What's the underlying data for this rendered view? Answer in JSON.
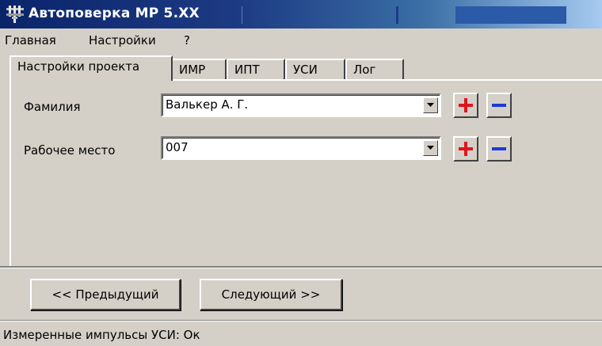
{
  "window": {
    "title": "Автоповерка МР 5.XX",
    "icon": "app-fork-icon"
  },
  "menu": {
    "items": [
      "Главная",
      "Настройки",
      "?"
    ]
  },
  "tabs": [
    {
      "label": "Настройки проекта",
      "active": true
    },
    {
      "label": "ИМР",
      "active": false
    },
    {
      "label": "ИПТ",
      "active": false
    },
    {
      "label": "УСИ",
      "active": false
    },
    {
      "label": "Лог",
      "active": false
    }
  ],
  "form": {
    "surname": {
      "label": "Фамилия",
      "value": "Валькер А. Г."
    },
    "workplace": {
      "label": "Рабочее место",
      "value": "007"
    }
  },
  "nav": {
    "prev_label": "<< Предыдущий",
    "next_label": "Следующий >>"
  },
  "status": {
    "text": "Измеренные импульсы УСИ: Ок"
  },
  "colors": {
    "title_active": "#0a246a",
    "add_icon": "#e0141e",
    "remove_icon": "#1a3ad8",
    "face": "#d4d0c8"
  }
}
